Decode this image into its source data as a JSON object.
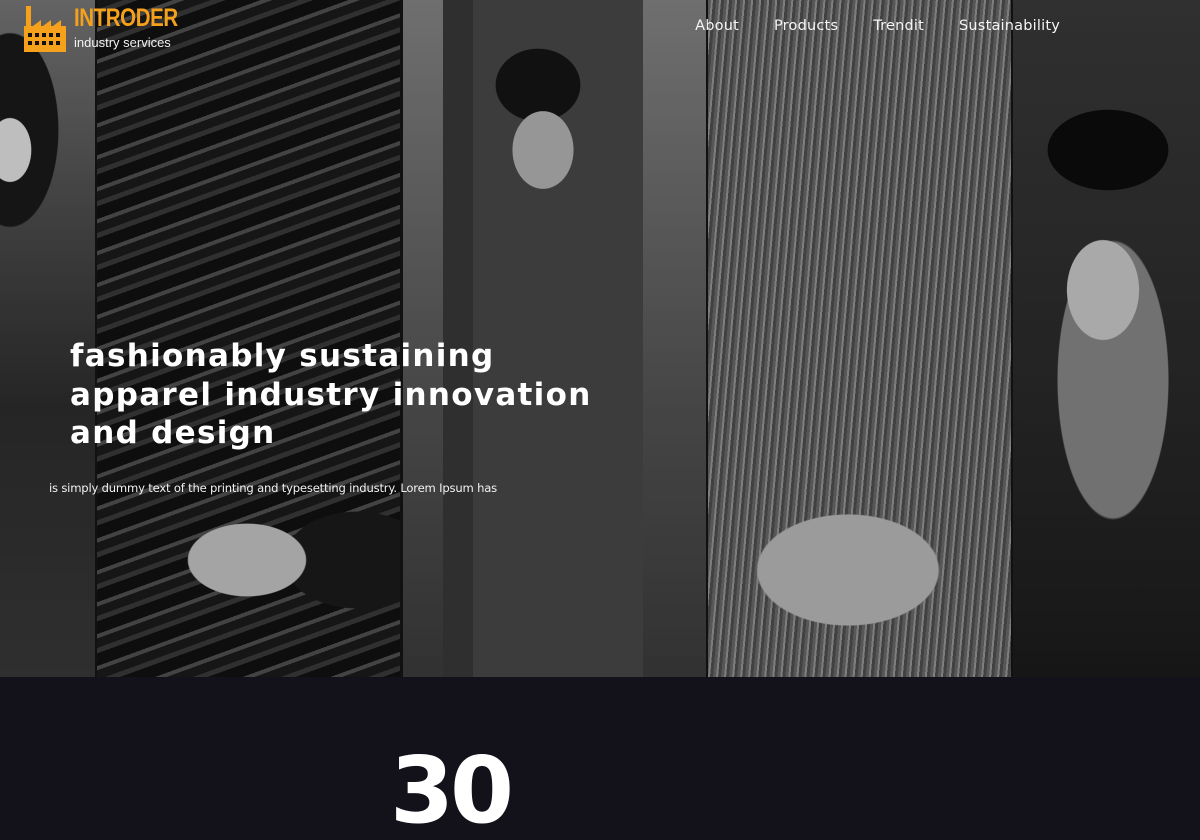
{
  "brand": {
    "name": "INTRODER",
    "tagline": "industry services",
    "accent": "#f5a11b"
  },
  "nav": {
    "items": [
      "About",
      "Products",
      "Trendit",
      "Sustainability"
    ]
  },
  "hero": {
    "headline": [
      "fashionably sustaining",
      "apparel industry innovation",
      "and design"
    ],
    "subtext": "is simply dummy text of the printing and typesetting industry. Lorem Ipsum has",
    "images": [
      "woman-denim-jacket-photo",
      "reclining-woman-water-photo",
      "man-suit-sunglasses-photo",
      "hair-closeup-photo",
      "woman-beanie-photo"
    ]
  },
  "stats": {
    "number": "30"
  },
  "colors": {
    "stats_background": "#13111a",
    "text": "#ffffff"
  }
}
